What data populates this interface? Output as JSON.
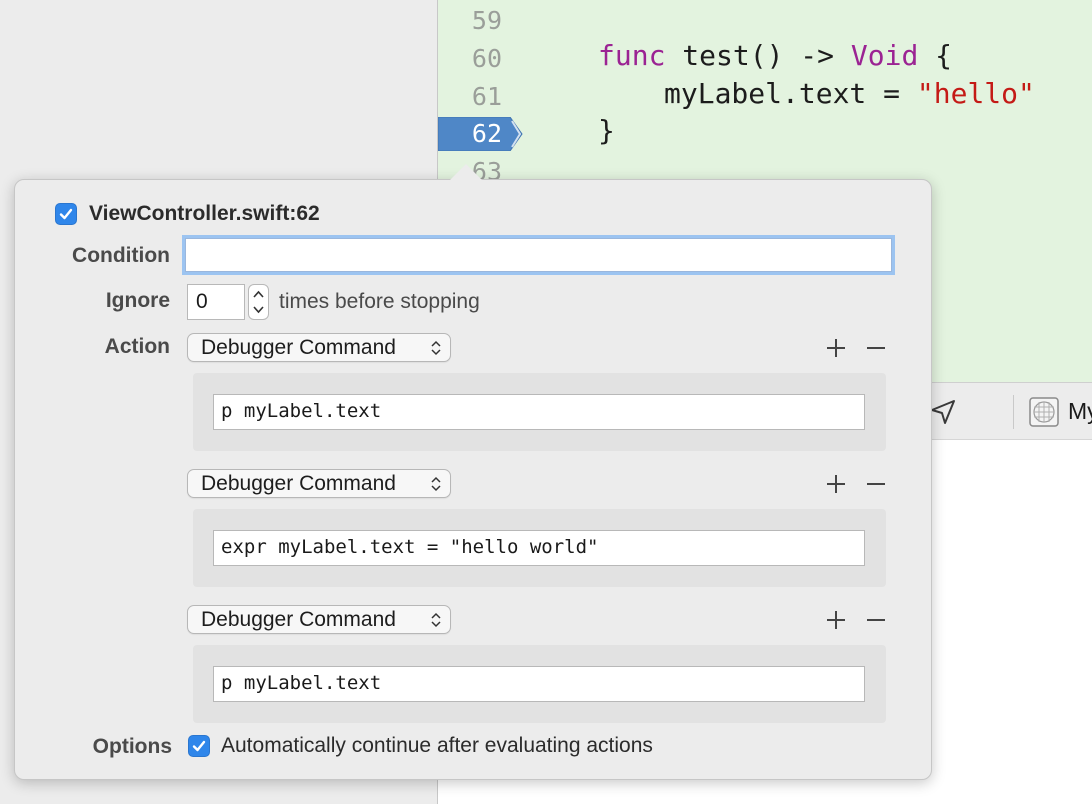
{
  "editor": {
    "line_numbers": [
      "59",
      "60",
      "61",
      "62",
      "63"
    ],
    "breakpoint_line": "62",
    "code": {
      "line1_kw": "func",
      "line1_rest": " test() -> ",
      "line1_type": "Void",
      "line1_end": " {",
      "line2_prefix": "myLabel.text = ",
      "line2_string": "\"hello\"",
      "line3": "}"
    }
  },
  "lower_toolbar": {
    "scheme_label": "My",
    "icons": [
      "location-arrow-icon",
      "device-grid-icon"
    ]
  },
  "breakpoint_editor": {
    "enabled": true,
    "title": "ViewController.swift:62",
    "condition_label": "Condition",
    "condition_value": "",
    "ignore_label": "Ignore",
    "ignore_value": "0",
    "ignore_suffix": "times before stopping",
    "action_label": "Action",
    "actions": [
      {
        "type": "Debugger Command",
        "command": "p myLabel.text"
      },
      {
        "type": "Debugger Command",
        "command": "expr myLabel.text = \"hello world\""
      },
      {
        "type": "Debugger Command",
        "command": "p myLabel.text"
      }
    ],
    "options_label": "Options",
    "auto_continue_checked": true,
    "auto_continue_label": "Automatically continue after evaluating actions"
  },
  "colors": {
    "editor_bg": "#e3f3df",
    "breakpoint_blue": "#4f87c7",
    "checkbox_blue": "#2f86ea",
    "keyword": "#9b2393",
    "string": "#c41a16"
  }
}
